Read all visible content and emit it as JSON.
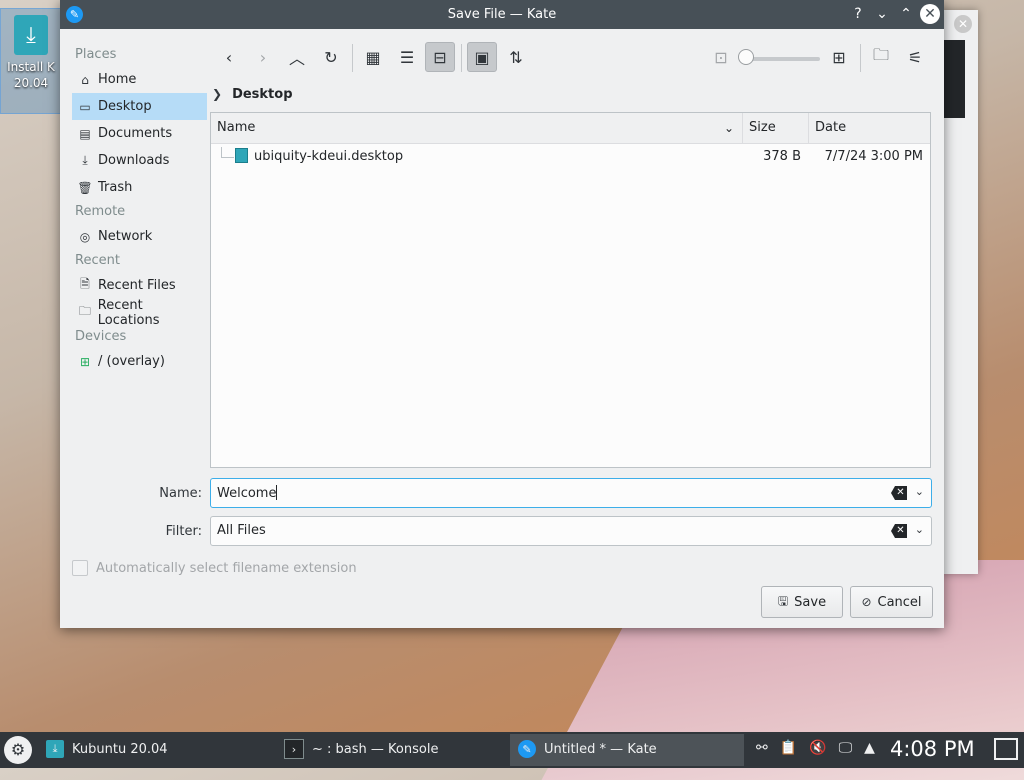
{
  "desktop": {
    "icon_label_line1": "Install K",
    "icon_label_line2": "20.04"
  },
  "dialog": {
    "title": "Save File — Kate",
    "title_buttons": [
      "?",
      "⌄",
      "⌃",
      "✕"
    ]
  },
  "sidebar": {
    "sections": [
      {
        "label": "Places",
        "items": [
          {
            "label": "Home",
            "icon": "home-icon"
          },
          {
            "label": "Desktop",
            "icon": "desktop-icon",
            "active": true
          },
          {
            "label": "Documents",
            "icon": "documents-icon"
          },
          {
            "label": "Downloads",
            "icon": "downloads-icon"
          },
          {
            "label": "Trash",
            "icon": "trash-icon"
          }
        ]
      },
      {
        "label": "Remote",
        "items": [
          {
            "label": "Network",
            "icon": "network-icon"
          }
        ]
      },
      {
        "label": "Recent",
        "items": [
          {
            "label": "Recent Files",
            "icon": "recent-files-icon"
          },
          {
            "label": "Recent Locations",
            "icon": "recent-locations-icon"
          }
        ]
      },
      {
        "label": "Devices",
        "items": [
          {
            "label": "/ (overlay)",
            "icon": "drive-icon"
          }
        ]
      }
    ]
  },
  "breadcrumb": {
    "current": "Desktop"
  },
  "filelist": {
    "columns": {
      "name": "Name",
      "size": "Size",
      "date": "Date"
    },
    "rows": [
      {
        "name": "ubiquity-kdeui.desktop",
        "size": "378 B",
        "date": "7/7/24 3:00 PM"
      }
    ]
  },
  "form": {
    "name_label": "Name:",
    "name_value": "Welcome",
    "filter_label": "Filter:",
    "filter_value": "All Files",
    "auto_ext_label": "Automatically select filename extension"
  },
  "buttons": {
    "save": "Save",
    "cancel": "Cancel"
  },
  "taskbar": {
    "tasks": [
      {
        "label": "Kubuntu 20.04"
      },
      {
        "label": "~ : bash — Konsole"
      },
      {
        "label": "Untitled * — Kate",
        "active": true
      }
    ],
    "clock": "4:08 PM"
  },
  "colors": {
    "accent": "#3daee9",
    "selection": "#b6dcf7",
    "titlebar": "#475057",
    "panel": "#31363b"
  }
}
